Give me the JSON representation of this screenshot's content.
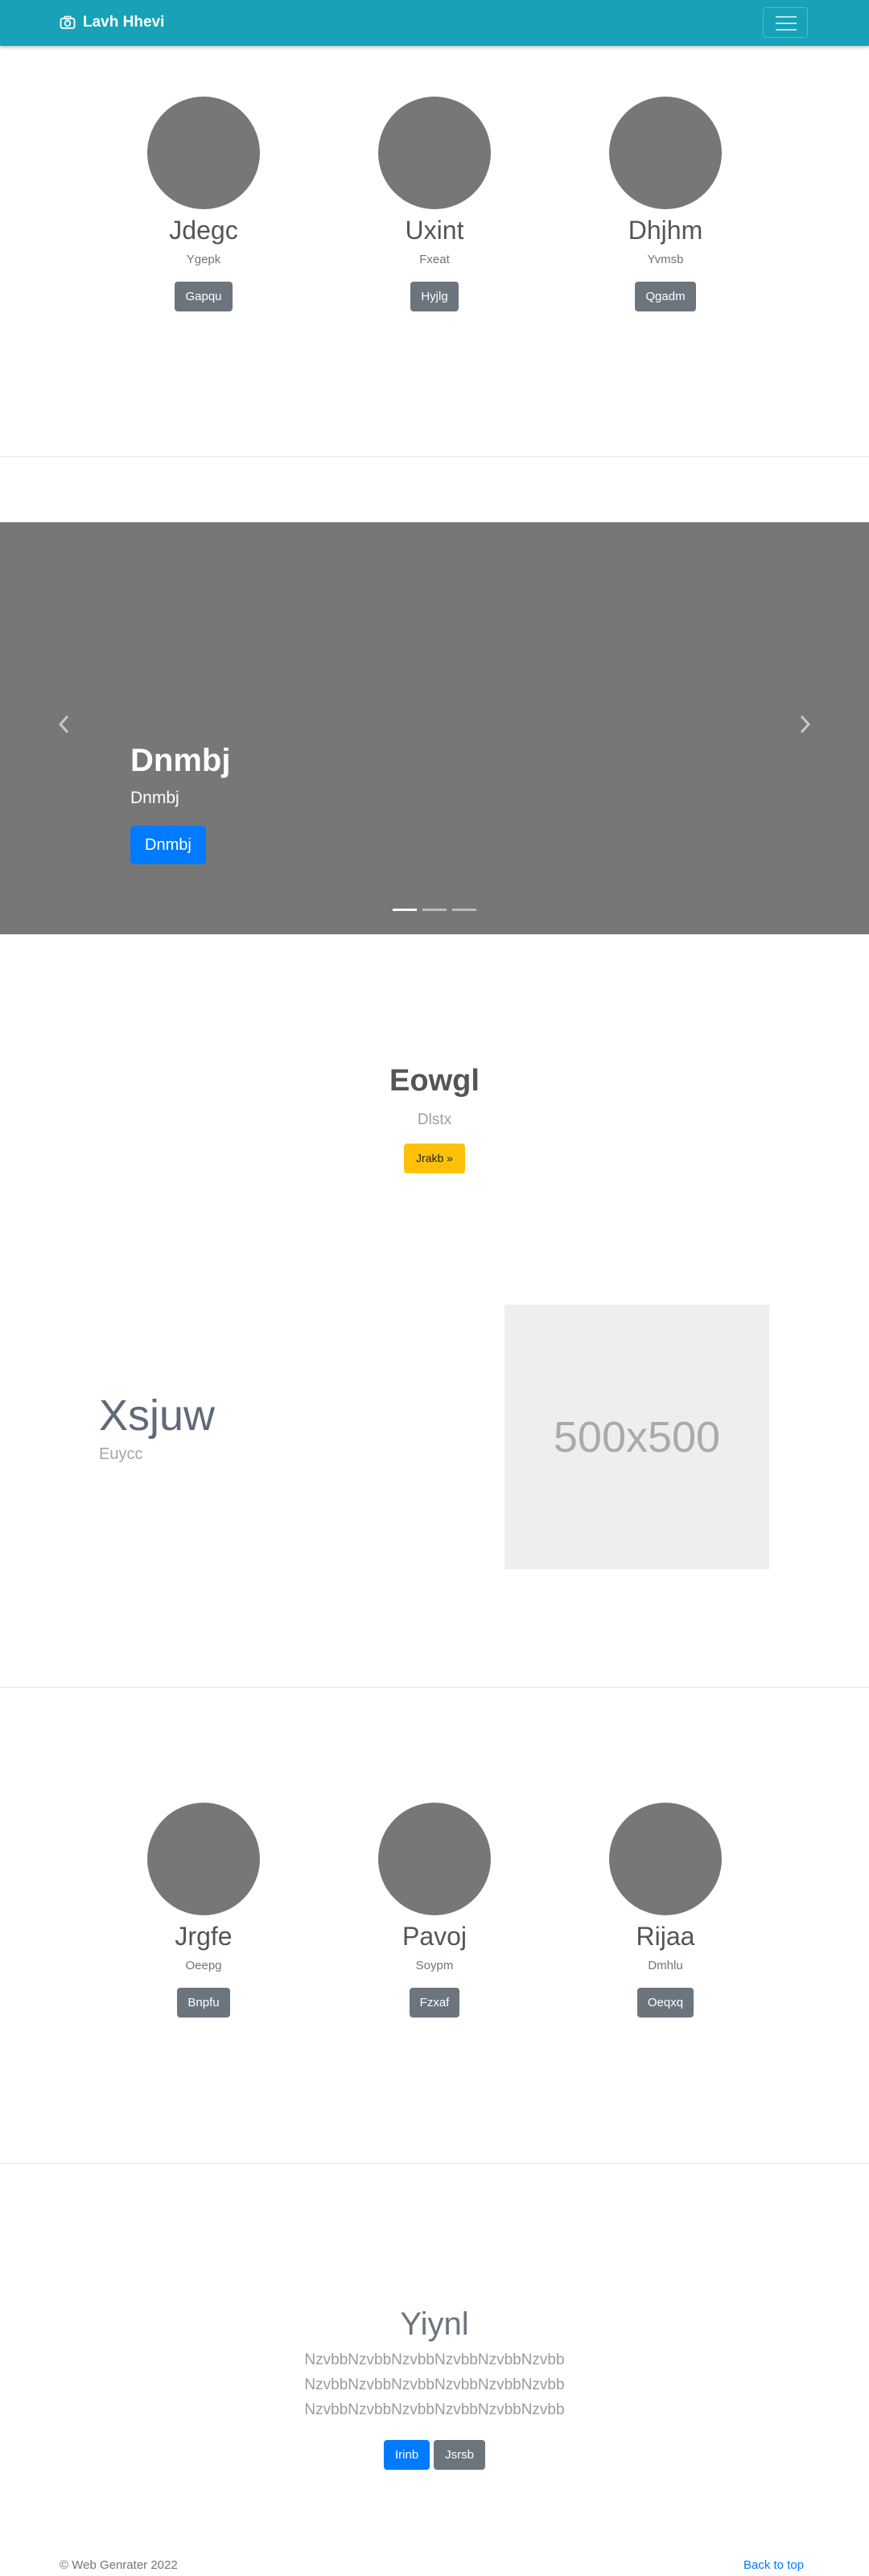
{
  "navbar": {
    "brand": "Lavh Hhevi",
    "icon": "camera-icon",
    "background": "#17a2b8"
  },
  "team_top": [
    {
      "name": "Jdegc",
      "role": "Ygepk",
      "button": "Gapqu"
    },
    {
      "name": "Uxint",
      "role": "Fxeat",
      "button": "Hyjlg"
    },
    {
      "name": "Dhjhm",
      "role": "Yvmsb",
      "button": "Qgadm"
    }
  ],
  "carousel": {
    "title": "Dnmbj",
    "text": "Dnmbj",
    "button": "Dnmbj",
    "prev_icon": "chevron-left-icon",
    "next_icon": "chevron-right-icon",
    "slides": 3,
    "active_slide": 1
  },
  "hero": {
    "title": "Eowgl",
    "subtitle": "Dlstx",
    "button": "Jrakb »"
  },
  "featurette": {
    "heading": "Xsjuw",
    "subtext": "Euycc",
    "image_label": "500x500"
  },
  "team_bottom": [
    {
      "name": "Jrgfe",
      "role": "Oeepg",
      "button": "Bnpfu"
    },
    {
      "name": "Pavoj",
      "role": "Soypm",
      "button": "Fzxaf"
    },
    {
      "name": "Rijaa",
      "role": "Dmhlu",
      "button": "Oeqxq"
    }
  ],
  "jumbotron": {
    "title": "Yiynl",
    "lines": [
      "NzvbbNzvbbNzvbbNzvbbNzvbbNzvbb",
      "NzvbbNzvbbNzvbbNzvbbNzvbbNzvbb",
      "NzvbbNzvbbNzvbbNzvbbNzvbbNzvbb"
    ],
    "primary_button": "Irinb",
    "secondary_button": "Jsrsb"
  },
  "footer": {
    "copyright": "© Web Genrater 2022",
    "back_to_top": "Back to top"
  }
}
